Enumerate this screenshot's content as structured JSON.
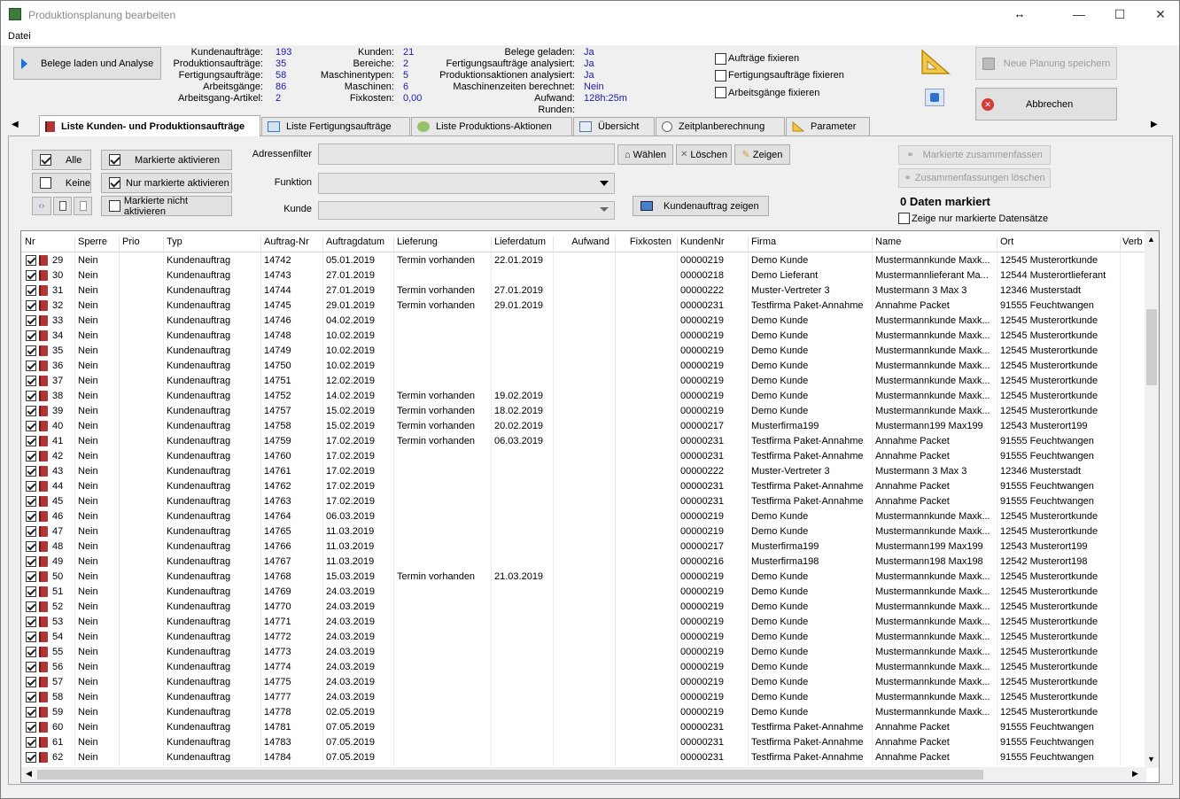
{
  "window": {
    "title": "Produktionsplanung bearbeiten",
    "resize_glyph": "↔"
  },
  "menu": {
    "file": "Datei"
  },
  "toolbar": {
    "load_button": "Belege laden und Analyse",
    "save_button": "Neue Planung speichern",
    "cancel_button": "Abbrechen"
  },
  "stats": {
    "col1": [
      {
        "label": "Kundenaufträge:",
        "value": "193"
      },
      {
        "label": "Produktionsaufträge:",
        "value": "35"
      },
      {
        "label": "Fertigungsaufträge:",
        "value": "58"
      },
      {
        "label": "Arbeitsgänge:",
        "value": "86"
      },
      {
        "label": "Arbeitsgang-Artikel:",
        "value": "2"
      }
    ],
    "col2": [
      {
        "label": "Kunden:",
        "value": "21"
      },
      {
        "label": "Bereiche:",
        "value": "2"
      },
      {
        "label": "Maschinentypen:",
        "value": "5"
      },
      {
        "label": "Maschinen:",
        "value": "6"
      },
      {
        "label": "Fixkosten:",
        "value": "0,00"
      }
    ],
    "col3": [
      {
        "label": "Belege geladen:",
        "value": "Ja"
      },
      {
        "label": "Fertigungsaufträge analysiert:",
        "value": "Ja"
      },
      {
        "label": "Produktionsaktionen analysiert:",
        "value": "Ja"
      },
      {
        "label": "Maschinenzeiten berechnet:",
        "value": "Nein"
      },
      {
        "label": "Aufwand:",
        "value": "128h:25m"
      },
      {
        "label": "Runden:",
        "value": ""
      }
    ]
  },
  "fix_options": [
    "Aufträge fixieren",
    "Fertigungsaufträge fixieren",
    "Arbeitsgänge fixieren"
  ],
  "tabs": [
    "Liste Kunden- und Produktionsaufträge",
    "Liste Fertigungsaufträge",
    "Liste Produktions-Aktionen",
    "Übersicht",
    "Zeitplanberechnung",
    "Parameter"
  ],
  "filter": {
    "btn_all": "Alle",
    "btn_none": "Keine",
    "btn_activate_marked": "Markierte aktivieren",
    "btn_only_marked": "Nur markierte aktivieren",
    "btn_not_activate": "Markierte nicht aktivieren",
    "address_label": "Adressenfilter",
    "function_label": "Funktion",
    "customer_label": "Kunde",
    "btn_choose": "Wählen",
    "btn_delete": "Löschen",
    "btn_show": "Zeigen",
    "btn_show_order": "Kundenauftrag zeigen",
    "btn_combine": "Markierte zusammenfassen",
    "btn_delete_combined": "Zusammenfassungen löschen",
    "marked_count": "0 Daten markiert",
    "only_marked_label": "Zeige nur markierte Datensätze"
  },
  "grid": {
    "columns": [
      "Nr",
      "Sperre",
      "Prio",
      "Typ",
      "Auftrag-Nr",
      "Auftragdatum",
      "Lieferung",
      "Lieferdatum",
      "Aufwand",
      "Fixkosten",
      "KundenNr",
      "Firma",
      "Name",
      "Ort",
      "Verb"
    ],
    "rows": [
      [
        "29",
        "Nein",
        "",
        "Kundenauftrag",
        "14742",
        "05.01.2019",
        "Termin vorhanden",
        "22.01.2019",
        "",
        "",
        "00000219",
        "Demo Kunde",
        "Mustermannkunde Maxk...",
        "12545 Musterortkunde"
      ],
      [
        "30",
        "Nein",
        "",
        "Kundenauftrag",
        "14743",
        "27.01.2019",
        "",
        "",
        "",
        "",
        "00000218",
        "Demo Lieferant",
        "Mustermannlieferant Ma...",
        "12544 Musterortlieferant"
      ],
      [
        "31",
        "Nein",
        "",
        "Kundenauftrag",
        "14744",
        "27.01.2019",
        "Termin vorhanden",
        "27.01.2019",
        "",
        "",
        "00000222",
        "Muster-Vertreter 3",
        "Mustermann 3 Max 3",
        "12346 Musterstadt"
      ],
      [
        "32",
        "Nein",
        "",
        "Kundenauftrag",
        "14745",
        "29.01.2019",
        "Termin vorhanden",
        "29.01.2019",
        "",
        "",
        "00000231",
        "Testfirma Paket-Annahme",
        "Annahme Packet",
        "91555 Feuchtwangen"
      ],
      [
        "33",
        "Nein",
        "",
        "Kundenauftrag",
        "14746",
        "04.02.2019",
        "",
        "",
        "",
        "",
        "00000219",
        "Demo Kunde",
        "Mustermannkunde Maxk...",
        "12545 Musterortkunde"
      ],
      [
        "34",
        "Nein",
        "",
        "Kundenauftrag",
        "14748",
        "10.02.2019",
        "",
        "",
        "",
        "",
        "00000219",
        "Demo Kunde",
        "Mustermannkunde Maxk...",
        "12545 Musterortkunde"
      ],
      [
        "35",
        "Nein",
        "",
        "Kundenauftrag",
        "14749",
        "10.02.2019",
        "",
        "",
        "",
        "",
        "00000219",
        "Demo Kunde",
        "Mustermannkunde Maxk...",
        "12545 Musterortkunde"
      ],
      [
        "36",
        "Nein",
        "",
        "Kundenauftrag",
        "14750",
        "10.02.2019",
        "",
        "",
        "",
        "",
        "00000219",
        "Demo Kunde",
        "Mustermannkunde Maxk...",
        "12545 Musterortkunde"
      ],
      [
        "37",
        "Nein",
        "",
        "Kundenauftrag",
        "14751",
        "12.02.2019",
        "",
        "",
        "",
        "",
        "00000219",
        "Demo Kunde",
        "Mustermannkunde Maxk...",
        "12545 Musterortkunde"
      ],
      [
        "38",
        "Nein",
        "",
        "Kundenauftrag",
        "14752",
        "14.02.2019",
        "Termin vorhanden",
        "19.02.2019",
        "",
        "",
        "00000219",
        "Demo Kunde",
        "Mustermannkunde Maxk...",
        "12545 Musterortkunde"
      ],
      [
        "39",
        "Nein",
        "",
        "Kundenauftrag",
        "14757",
        "15.02.2019",
        "Termin vorhanden",
        "18.02.2019",
        "",
        "",
        "00000219",
        "Demo Kunde",
        "Mustermannkunde Maxk...",
        "12545 Musterortkunde"
      ],
      [
        "40",
        "Nein",
        "",
        "Kundenauftrag",
        "14758",
        "15.02.2019",
        "Termin vorhanden",
        "20.02.2019",
        "",
        "",
        "00000217",
        "Musterfirma199",
        "Mustermann199 Max199",
        "12543 Musterort199"
      ],
      [
        "41",
        "Nein",
        "",
        "Kundenauftrag",
        "14759",
        "17.02.2019",
        "Termin vorhanden",
        "06.03.2019",
        "",
        "",
        "00000231",
        "Testfirma Paket-Annahme",
        "Annahme Packet",
        "91555 Feuchtwangen"
      ],
      [
        "42",
        "Nein",
        "",
        "Kundenauftrag",
        "14760",
        "17.02.2019",
        "",
        "",
        "",
        "",
        "00000231",
        "Testfirma Paket-Annahme",
        "Annahme Packet",
        "91555 Feuchtwangen"
      ],
      [
        "43",
        "Nein",
        "",
        "Kundenauftrag",
        "14761",
        "17.02.2019",
        "",
        "",
        "",
        "",
        "00000222",
        "Muster-Vertreter 3",
        "Mustermann 3 Max 3",
        "12346 Musterstadt"
      ],
      [
        "44",
        "Nein",
        "",
        "Kundenauftrag",
        "14762",
        "17.02.2019",
        "",
        "",
        "",
        "",
        "00000231",
        "Testfirma Paket-Annahme",
        "Annahme Packet",
        "91555 Feuchtwangen"
      ],
      [
        "45",
        "Nein",
        "",
        "Kundenauftrag",
        "14763",
        "17.02.2019",
        "",
        "",
        "",
        "",
        "00000231",
        "Testfirma Paket-Annahme",
        "Annahme Packet",
        "91555 Feuchtwangen"
      ],
      [
        "46",
        "Nein",
        "",
        "Kundenauftrag",
        "14764",
        "06.03.2019",
        "",
        "",
        "",
        "",
        "00000219",
        "Demo Kunde",
        "Mustermannkunde Maxk...",
        "12545 Musterortkunde"
      ],
      [
        "47",
        "Nein",
        "",
        "Kundenauftrag",
        "14765",
        "11.03.2019",
        "",
        "",
        "",
        "",
        "00000219",
        "Demo Kunde",
        "Mustermannkunde Maxk...",
        "12545 Musterortkunde"
      ],
      [
        "48",
        "Nein",
        "",
        "Kundenauftrag",
        "14766",
        "11.03.2019",
        "",
        "",
        "",
        "",
        "00000217",
        "Musterfirma199",
        "Mustermann199 Max199",
        "12543 Musterort199"
      ],
      [
        "49",
        "Nein",
        "",
        "Kundenauftrag",
        "14767",
        "11.03.2019",
        "",
        "",
        "",
        "",
        "00000216",
        "Musterfirma198",
        "Mustermann198 Max198",
        "12542 Musterort198"
      ],
      [
        "50",
        "Nein",
        "",
        "Kundenauftrag",
        "14768",
        "15.03.2019",
        "Termin vorhanden",
        "21.03.2019",
        "",
        "",
        "00000219",
        "Demo Kunde",
        "Mustermannkunde Maxk...",
        "12545 Musterortkunde"
      ],
      [
        "51",
        "Nein",
        "",
        "Kundenauftrag",
        "14769",
        "24.03.2019",
        "",
        "",
        "",
        "",
        "00000219",
        "Demo Kunde",
        "Mustermannkunde Maxk...",
        "12545 Musterortkunde"
      ],
      [
        "52",
        "Nein",
        "",
        "Kundenauftrag",
        "14770",
        "24.03.2019",
        "",
        "",
        "",
        "",
        "00000219",
        "Demo Kunde",
        "Mustermannkunde Maxk...",
        "12545 Musterortkunde"
      ],
      [
        "53",
        "Nein",
        "",
        "Kundenauftrag",
        "14771",
        "24.03.2019",
        "",
        "",
        "",
        "",
        "00000219",
        "Demo Kunde",
        "Mustermannkunde Maxk...",
        "12545 Musterortkunde"
      ],
      [
        "54",
        "Nein",
        "",
        "Kundenauftrag",
        "14772",
        "24.03.2019",
        "",
        "",
        "",
        "",
        "00000219",
        "Demo Kunde",
        "Mustermannkunde Maxk...",
        "12545 Musterortkunde"
      ],
      [
        "55",
        "Nein",
        "",
        "Kundenauftrag",
        "14773",
        "24.03.2019",
        "",
        "",
        "",
        "",
        "00000219",
        "Demo Kunde",
        "Mustermannkunde Maxk...",
        "12545 Musterortkunde"
      ],
      [
        "56",
        "Nein",
        "",
        "Kundenauftrag",
        "14774",
        "24.03.2019",
        "",
        "",
        "",
        "",
        "00000219",
        "Demo Kunde",
        "Mustermannkunde Maxk...",
        "12545 Musterortkunde"
      ],
      [
        "57",
        "Nein",
        "",
        "Kundenauftrag",
        "14775",
        "24.03.2019",
        "",
        "",
        "",
        "",
        "00000219",
        "Demo Kunde",
        "Mustermannkunde Maxk...",
        "12545 Musterortkunde"
      ],
      [
        "58",
        "Nein",
        "",
        "Kundenauftrag",
        "14777",
        "24.03.2019",
        "",
        "",
        "",
        "",
        "00000219",
        "Demo Kunde",
        "Mustermannkunde Maxk...",
        "12545 Musterortkunde"
      ],
      [
        "59",
        "Nein",
        "",
        "Kundenauftrag",
        "14778",
        "02.05.2019",
        "",
        "",
        "",
        "",
        "00000219",
        "Demo Kunde",
        "Mustermannkunde Maxk...",
        "12545 Musterortkunde"
      ],
      [
        "60",
        "Nein",
        "",
        "Kundenauftrag",
        "14781",
        "07.05.2019",
        "",
        "",
        "",
        "",
        "00000231",
        "Testfirma Paket-Annahme",
        "Annahme Packet",
        "91555 Feuchtwangen"
      ],
      [
        "61",
        "Nein",
        "",
        "Kundenauftrag",
        "14783",
        "07.05.2019",
        "",
        "",
        "",
        "",
        "00000231",
        "Testfirma Paket-Annahme",
        "Annahme Packet",
        "91555 Feuchtwangen"
      ],
      [
        "62",
        "Nein",
        "",
        "Kundenauftrag",
        "14784",
        "07.05.2019",
        "",
        "",
        "",
        "",
        "00000231",
        "Testfirma Paket-Annahme",
        "Annahme Packet",
        "91555 Feuchtwangen"
      ]
    ]
  },
  "colors": {
    "value_blue": "#1a1aa8",
    "tab_active": "#ffffff",
    "icon_red": "#b03535"
  }
}
